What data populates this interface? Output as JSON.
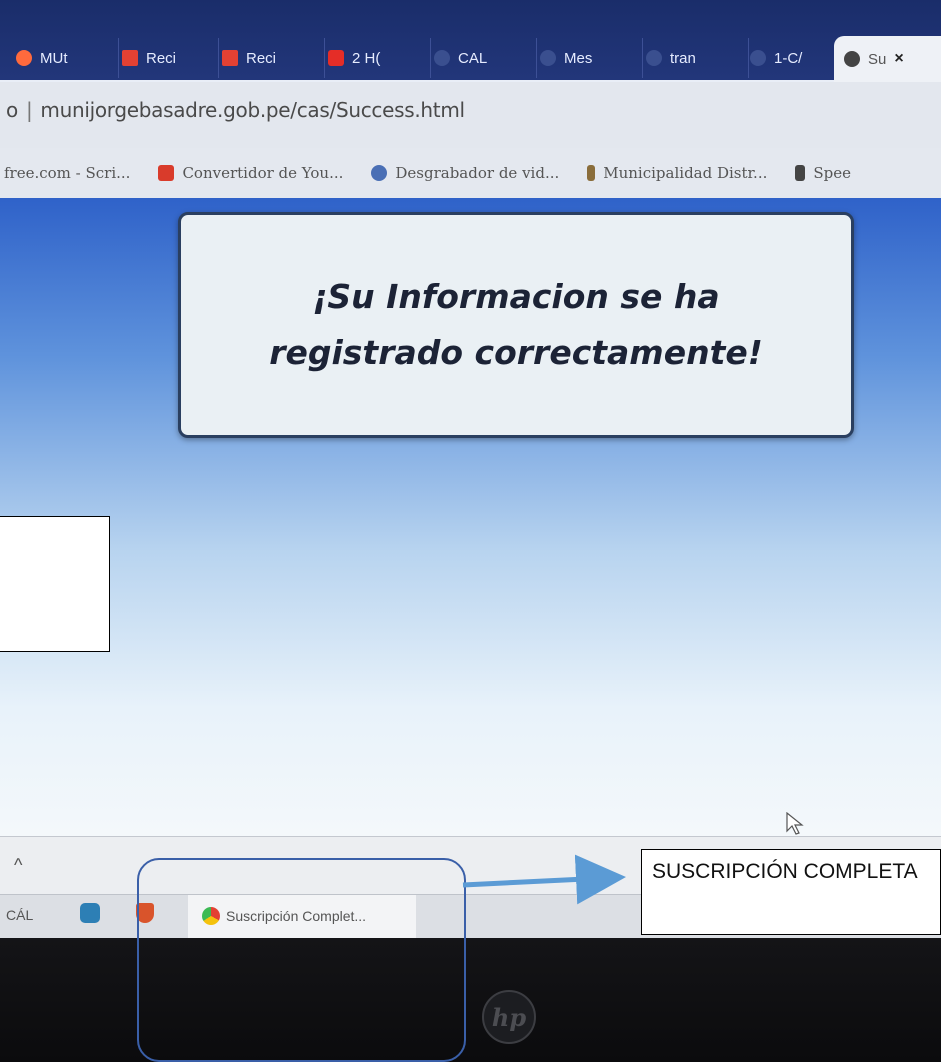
{
  "browser": {
    "tabs": [
      {
        "label": "MUt",
        "icon": "moon-icon",
        "color": "#ff6a3d"
      },
      {
        "label": "Reci",
        "icon": "gmail-icon",
        "color": "#e34133"
      },
      {
        "label": "Reci",
        "icon": "gmail-icon",
        "color": "#e34133"
      },
      {
        "label": "2 H(",
        "icon": "video-icon",
        "color": "#e52d27"
      },
      {
        "label": "CAL",
        "icon": "globe-icon",
        "color": "#3a4f8f"
      },
      {
        "label": "Mes",
        "icon": "globe-icon",
        "color": "#3a4f8f"
      },
      {
        "label": "tran",
        "icon": "globe-icon",
        "color": "#3a4f8f"
      },
      {
        "label": "1-C/",
        "icon": "globe-icon",
        "color": "#3a4f8f"
      },
      {
        "label": "Su",
        "icon": "globe-icon",
        "color": "#444444",
        "active": true
      }
    ],
    "close_glyph": "×",
    "address": {
      "prefix": "o",
      "separator": "|",
      "url": "munijorgebasadre.gob.pe/cas/Success.html"
    },
    "bookmarks": [
      {
        "label": "free.com - Scri...",
        "icon": "",
        "color": ""
      },
      {
        "label": "Convertidor de You...",
        "icon": "play-icon",
        "color": "#d93b2b"
      },
      {
        "label": "Desgrabador de vid...",
        "icon": "circle-icon",
        "color": "#4a6fb5"
      },
      {
        "label": "Municipalidad Distr...",
        "icon": "bottle-icon",
        "color": "#8a6d3b"
      },
      {
        "label": "Spee",
        "icon": "mic-icon",
        "color": "#444444"
      }
    ]
  },
  "page": {
    "message": "¡Su Informacion se ha registrado correctamente!"
  },
  "taskbar": {
    "left_label": "CÁL",
    "active_item_label": "Suscripción Complet..."
  },
  "annotation": {
    "label": "SUSCRIPCIÓN COMPLETA",
    "arrow_color": "#5b9bd5",
    "highlight_color": "#3a5fa8"
  },
  "bezel": {
    "logo": "hp"
  }
}
